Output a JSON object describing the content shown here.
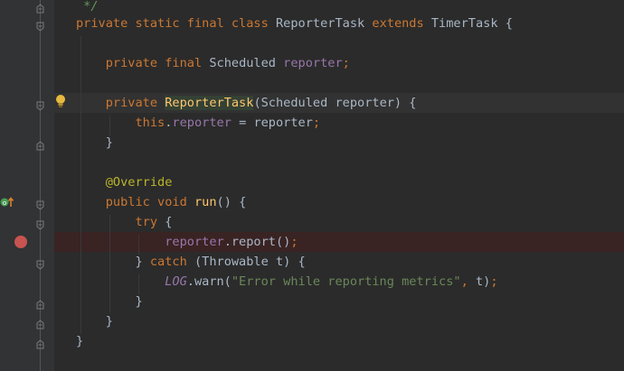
{
  "editor": {
    "lines": [
      {
        "tokens": [
          {
            "t": "cmt",
            "v": " */"
          }
        ]
      },
      {
        "tokens": [
          {
            "t": "kw",
            "v": "private static final class "
          },
          {
            "t": "cls",
            "v": "ReporterTask "
          },
          {
            "t": "kw",
            "v": "extends "
          },
          {
            "t": "cls",
            "v": "TimerTask {"
          }
        ]
      },
      {
        "tokens": []
      },
      {
        "tokens": [
          {
            "t": "kw",
            "v": "    private final "
          },
          {
            "t": "cls",
            "v": "Scheduled "
          },
          {
            "t": "fld",
            "v": "reporter"
          },
          {
            "t": "semi",
            "v": ";"
          }
        ]
      },
      {
        "tokens": []
      },
      {
        "tokens": [
          {
            "t": "kw",
            "v": "    private "
          },
          {
            "t": "caret",
            "v": ""
          },
          {
            "t": "mth-hl",
            "v": "ReporterTask"
          },
          {
            "t": "punc",
            "v": "(Scheduled reporter) {"
          }
        ]
      },
      {
        "tokens": [
          {
            "t": "kw",
            "v": "        this"
          },
          {
            "t": "punc",
            "v": "."
          },
          {
            "t": "fld",
            "v": "reporter"
          },
          {
            "t": "punc",
            "v": " = reporter"
          },
          {
            "t": "semi",
            "v": ";"
          }
        ]
      },
      {
        "tokens": [
          {
            "t": "punc",
            "v": "    }"
          }
        ]
      },
      {
        "tokens": []
      },
      {
        "tokens": [
          {
            "t": "ann",
            "v": "    @Override"
          }
        ]
      },
      {
        "tokens": [
          {
            "t": "kw",
            "v": "    public void "
          },
          {
            "t": "mth",
            "v": "run"
          },
          {
            "t": "punc",
            "v": "() {"
          }
        ]
      },
      {
        "tokens": [
          {
            "t": "kw",
            "v": "        try "
          },
          {
            "t": "punc",
            "v": "{"
          }
        ]
      },
      {
        "tokens": [
          {
            "t": "fld",
            "v": "            reporter"
          },
          {
            "t": "punc",
            "v": ".report()"
          },
          {
            "t": "semi",
            "v": ";"
          }
        ]
      },
      {
        "tokens": [
          {
            "t": "punc",
            "v": "        } "
          },
          {
            "t": "kw",
            "v": "catch "
          },
          {
            "t": "punc",
            "v": "(Throwable t) {"
          }
        ]
      },
      {
        "tokens": [
          {
            "t": "static-fld",
            "v": "            LOG"
          },
          {
            "t": "punc",
            "v": ".warn("
          },
          {
            "t": "str",
            "v": "\"Error while reporting metrics\""
          },
          {
            "t": "semi",
            "v": ", "
          },
          {
            "t": "punc",
            "v": "t)"
          },
          {
            "t": "semi",
            "v": ";"
          }
        ]
      },
      {
        "tokens": [
          {
            "t": "punc",
            "v": "        }"
          }
        ]
      },
      {
        "tokens": [
          {
            "t": "punc",
            "v": "    }"
          }
        ]
      },
      {
        "tokens": [
          {
            "t": "punc",
            "v": "}"
          }
        ]
      }
    ]
  },
  "gutter": {
    "breakpoint_icon": "breakpoint-icon",
    "bulb_icon": "intention-bulb-icon",
    "override_icon": "overrides-method-icon",
    "fold_icon": "fold-marker-icon"
  },
  "colors": {
    "background": "#2b2b2b",
    "gutter": "#313335",
    "keyword": "#cc7832",
    "string": "#6a8759",
    "field": "#9876aa",
    "method": "#ffc66d",
    "annotation": "#bbb529",
    "breakpoint": "#c75450"
  }
}
